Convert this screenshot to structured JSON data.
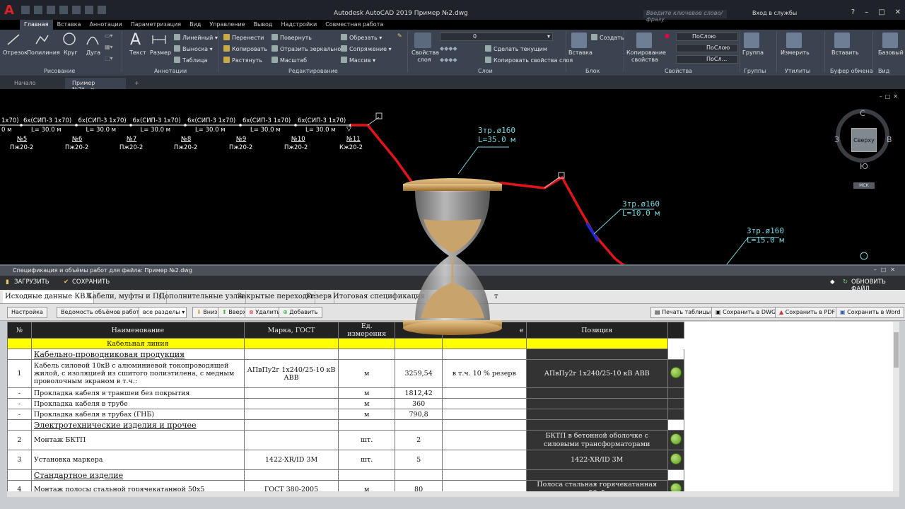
{
  "app": {
    "title": "Autodesk AutoCAD 2019   Пример №2.dwg",
    "search_placeholder": "Введите ключевое слово/фразу",
    "signin": "Вход в службы",
    "logo": "A"
  },
  "menu_tabs": [
    "Главная",
    "Вставка",
    "Аннотации",
    "Параметризация",
    "Вид",
    "Управление",
    "Вывод",
    "Надстройки",
    "Совместная работа"
  ],
  "ribbon": {
    "draw": {
      "line": "Отрезок",
      "polyline": "Полилиния",
      "circle": "Круг",
      "arc": "Дуга",
      "group": "Рисование"
    },
    "annot": {
      "text": "Текст",
      "dim": "Размер",
      "linear": "Линейный",
      "leader": "Выноска",
      "table": "Таблица",
      "group": "Аннотации"
    },
    "modify": {
      "move": "Перенести",
      "rotate": "Повернуть",
      "trim": "Обрезать",
      "copy": "Копировать",
      "mirror": "Отразить зеркально",
      "fillet": "Сопряжение",
      "stretch": "Растянуть",
      "scale": "Масштаб",
      "array": "Массив",
      "group": "Редактирование"
    },
    "layers": {
      "props": "Свойства слоя",
      "layer_value": "0",
      "make_current": "Сделать текущим",
      "match_layer": "Копировать свойства слоя",
      "group": "Слои"
    },
    "block": {
      "insert": "Вставка",
      "create": "Создать",
      "group": "Блок"
    },
    "props": {
      "match": "Копирование свойства",
      "bylayer1": "ПоСлою",
      "bylayer2": "ПоСлою",
      "bylayer3": "ПоСл...",
      "group": "Свойства"
    },
    "groups": {
      "group_btn": "Группа",
      "group": "Группы"
    },
    "utils": {
      "measure": "Измерить",
      "group": "Утилиты"
    },
    "clip": {
      "paste": "Вставить",
      "group": "Буфер обмена"
    },
    "view": {
      "base": "Базовый",
      "group": "Вид"
    }
  },
  "doc_tabs": {
    "start": "Начало",
    "file": "Пример №2*"
  },
  "viewcube": {
    "north": "С",
    "south": "Ю",
    "west": "З",
    "east": "В",
    "face": "Сверху",
    "ucs": "МСК"
  },
  "drawing": {
    "cable_labels": [
      "6х(СИП-3 1х70)",
      "6х(СИП-3 1х70)",
      "6х(СИП-3 1х70)",
      "6х(СИП-3 1х70)",
      "6х(СИП-3 1х70)",
      "6х(СИП-3 1х70)"
    ],
    "cable_lengths": [
      "L= 30.0 м",
      "L= 30.0 м",
      "L= 30.0 м",
      "L= 30.0 м",
      "L= 30.0 м",
      "L= 30.0 м"
    ],
    "partial_left_top": "1х70)",
    "partial_left_bottom": "0 м",
    "pole_numbers": [
      "№5",
      "№6",
      "№7",
      "№8",
      "№9",
      "№10",
      "№11"
    ],
    "pole_types": [
      "Пж20-2",
      "Пж20-2",
      "Пж20-2",
      "Пж20-2",
      "Пж20-2",
      "Пж20-2",
      "Кж20-2"
    ],
    "pipes": [
      {
        "name": "3тр.ø160",
        "len": "L=35.0 м"
      },
      {
        "name": "3тр.ø160",
        "len": "L=10.0 м"
      },
      {
        "name": "3тр.ø160",
        "len": "L=15.0 м"
      }
    ],
    "colors": {
      "route": "#e0151b",
      "labels": "#ffffff",
      "pipe_labels": "#7ad6e0",
      "segment": "#1c2bd6"
    }
  },
  "spec": {
    "title": "Спецификация и объёмы работ для файла: Пример №2.dwg",
    "load": "ЗАГРУЗИТЬ",
    "save": "СОХРАНИТЬ",
    "refresh": "ОБНОВИТЬ ФАЙЛ",
    "tabs": [
      "Исходные данные КВЛ",
      "Кабели, муфты и ПС",
      "Дополнительные узлы",
      "Закрытые переходы",
      "Резерв",
      "Итоговая спецификация",
      "т"
    ],
    "toolbar": {
      "settings": "Настройка",
      "statement": "Ведомость объёмов работ",
      "sections": "все разделы",
      "down": "Вниз",
      "up": "Вверх",
      "delete": "Удалить",
      "add": "Добавить",
      "print": "Печать таблицы",
      "save_dwg": "Сохранить в DWG",
      "save_pdf": "Сохранить в PDF",
      "save_word": "Сохранить в Word"
    },
    "headers": [
      "№",
      "Наименование",
      "Марка, ГОСТ",
      "Ед. измерения",
      "Ко",
      "е",
      "Позиция"
    ],
    "category": "Кабельная линия",
    "rows": [
      {
        "type": "section",
        "name": "Кабельно-проводниковая продукция"
      },
      {
        "type": "item",
        "num": "1",
        "name": "Кабель силовой 10кВ с алюминиевой токопроводящей жилой, с изоляцией из сшитого полиэтилена, с медным проволочным экраном в т.ч.:",
        "mark": "АПвПу2г 1х240/25-10 кВ АВВ",
        "unit": "м",
        "qty": "3259,54",
        "note": "в т.ч. 10 % резерв",
        "pos": "АПвПу2г 1х240/25-10 кВ АВВ",
        "ok": true,
        "h": 40
      },
      {
        "type": "item",
        "num": "-",
        "name": "Прокладка кабеля в траншеи без покрытия",
        "mark": "",
        "unit": "м",
        "qty": "1812,42",
        "note": "",
        "pos": "",
        "ok": false,
        "h": 15
      },
      {
        "type": "item",
        "num": "-",
        "name": "Прокладка кабеля в трубе",
        "mark": "",
        "unit": "м",
        "qty": "360",
        "note": "",
        "pos": "",
        "ok": false,
        "h": 15
      },
      {
        "type": "item",
        "num": "-",
        "name": "Прокладка кабеля в трубах (ГНБ)",
        "mark": "",
        "unit": "м",
        "qty": "790,8",
        "note": "",
        "pos": "",
        "ok": false,
        "h": 15
      },
      {
        "type": "section",
        "name": "Электротехнические изделия и прочее"
      },
      {
        "type": "item",
        "num": "2",
        "name": "Монтаж БКТП",
        "mark": "",
        "unit": "шт.",
        "qty": "2",
        "note": "",
        "pos": "БКТП в бетонной оболочке с силовыми трансформаторами",
        "ok": true,
        "h": 28
      },
      {
        "type": "item",
        "num": "3",
        "name": "Установка маркера",
        "mark": "1422-XR/ID 3M",
        "unit": "шт.",
        "qty": "5",
        "note": "",
        "pos": "1422-XR/ID 3M",
        "ok": true,
        "h": 28
      },
      {
        "type": "section",
        "name": "Стандартное изделие"
      },
      {
        "type": "item",
        "num": "4",
        "name": "Монтаж полосы стальной горячекатанной 50х5",
        "mark": "ГОСТ 380-2005",
        "unit": "м",
        "qty": "80",
        "note": "",
        "pos": "Полоса стальная горячекатанная 50х5",
        "ok": true,
        "h": 24
      }
    ]
  }
}
